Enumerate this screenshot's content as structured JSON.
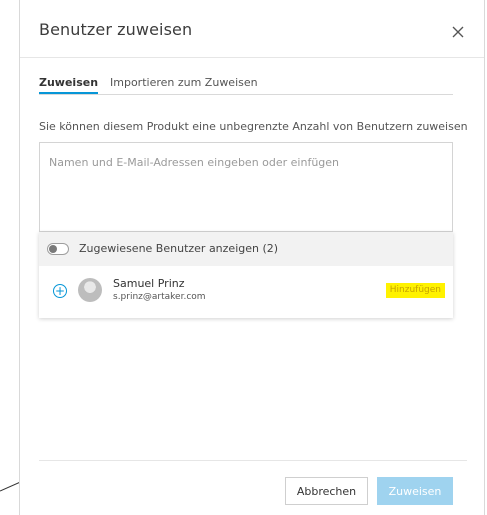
{
  "dialog": {
    "title": "Benutzer zuweisen",
    "close_icon": "close-icon"
  },
  "tabs": [
    {
      "label": "Zuweisen",
      "active": true
    },
    {
      "label": "Importieren zum Zuweisen",
      "active": false
    }
  ],
  "description": "Sie können diesem Produkt eine unbegrenzte Anzahl von Benutzern zuweisen",
  "input": {
    "value": "",
    "placeholder": "Namen und E-Mail-Adressen eingeben oder einfügen"
  },
  "toggle": {
    "label": "Zugewiesene Benutzer anzeigen (2)",
    "on": false
  },
  "user": {
    "name": "Samuel Prinz",
    "email": "s.prinz@artaker.com",
    "add_label": "Hinzufügen",
    "add_icon": "plus-circle-icon",
    "highlight_color": "#fff200"
  },
  "footer": {
    "cancel_label": "Abbrechen",
    "assign_label": "Zuweisen"
  },
  "colors": {
    "accent": "#0696d7",
    "assign_button_disabled": "#9fd3ef"
  }
}
